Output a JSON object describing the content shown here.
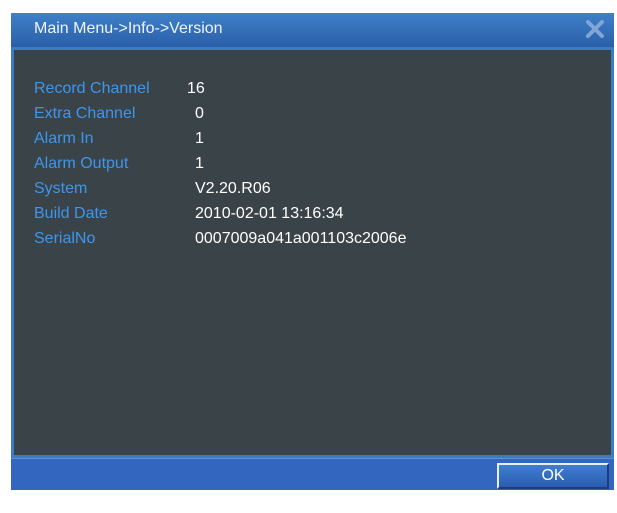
{
  "window": {
    "title": "Main Menu->Info->Version"
  },
  "info": {
    "rows": [
      {
        "label": "Record Channel",
        "value": "16"
      },
      {
        "label": "Extra Channel",
        "value": "0"
      },
      {
        "label": "Alarm In",
        "value": "1"
      },
      {
        "label": "Alarm Output",
        "value": "1"
      },
      {
        "label": "System",
        "value": "V2.20.R06"
      },
      {
        "label": "Build Date",
        "value": "2010-02-01 13:16:34"
      },
      {
        "label": "SerialNo",
        "value": "0007009a041a001103c2006e"
      }
    ]
  },
  "footer": {
    "ok_label": "OK"
  },
  "colors": {
    "title_bar": "#3a76c2",
    "panel_background": "#3a4448",
    "label_text": "#3d96ee",
    "value_text": "#ffffff",
    "footer_bar": "#3366bf"
  }
}
